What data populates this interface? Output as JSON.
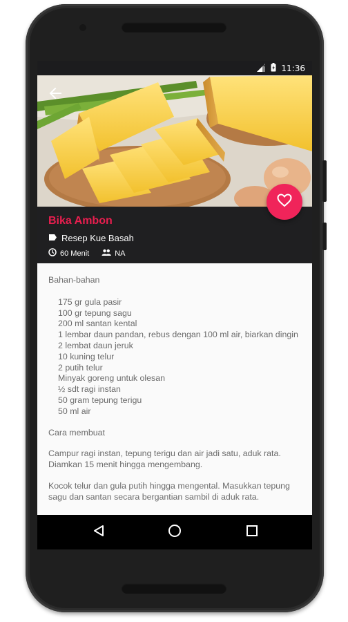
{
  "status": {
    "time": "11:36"
  },
  "recipe": {
    "title": "Bika Ambon",
    "category": "Resep Kue Basah",
    "duration": "60 Menit",
    "servings": "NA"
  },
  "content": {
    "ingredients_heading": "Bahan-bahan",
    "ingredients": [
      "175 gr gula pasir",
      "100 gr tepung sagu",
      "200 ml santan kental",
      "1 lembar daun pandan, rebus dengan 100 ml air, biarkan dingin",
      "2 lembat daun jeruk",
      "10 kuning telur",
      "2 putih telur",
      "Minyak goreng untuk olesan",
      "½ sdt ragi instan",
      "50 gram tepung terigu",
      "50 ml air"
    ],
    "method_heading": "Cara membuat",
    "steps": [
      "Campur ragi instan, tepung terigu dan air jadi satu, aduk rata. Diamkan 15 menit hingga mengembang.",
      "Kocok telur dan gula putih hingga mengental. Masukkan tepung sagu dan santan secara bergantian sambil di aduk rata."
    ]
  },
  "icons": {
    "back": "arrow-back-icon",
    "favorite": "heart-icon",
    "category": "tag-icon",
    "duration": "clock-icon",
    "servings": "people-icon",
    "nav_back": "triangle-back-icon",
    "nav_home": "circle-home-icon",
    "nav_recents": "square-recents-icon"
  },
  "colors": {
    "accent": "#f0245a",
    "title": "#e91e4f",
    "info_bg": "#1f1f21"
  }
}
